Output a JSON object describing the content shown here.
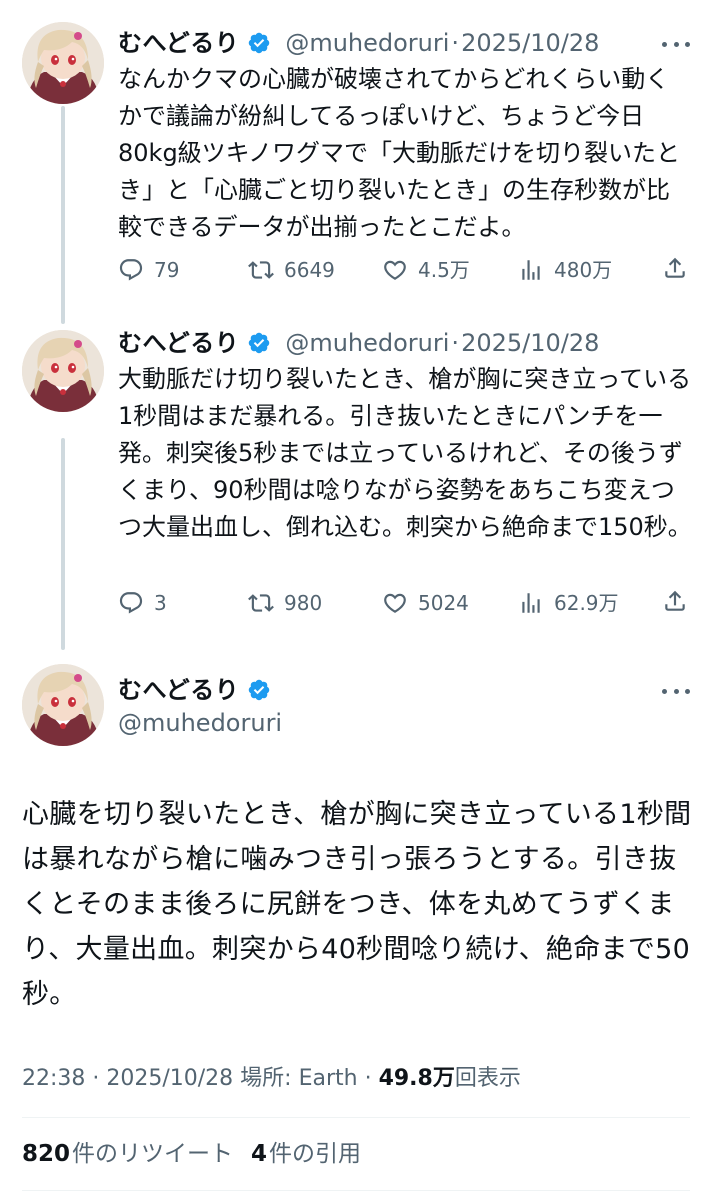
{
  "author": {
    "name": "むへどるり",
    "handle": "@muhedoruri",
    "verified_color": "#1d9bf0"
  },
  "tweets": [
    {
      "date": "2025/10/28",
      "text": "なんかクマの心臓が破壊されてからどれくらい動くかで議論が紛糾してるっぽいけど、ちょうど今日80kg級ツキノワグマで「大動脈だけを切り裂いたとき」と「心臓ごと切り裂いたとき」の生存秒数が比較できるデータが出揃ったとこだよ。",
      "replies": "79",
      "retweets": "6649",
      "likes": "4.5万",
      "views": "480万"
    },
    {
      "date": "2025/10/28",
      "text": "大動脈だけ切り裂いたとき、槍が胸に突き立っている1秒間はまだ暴れる。引き抜いたときにパンチを一発。刺突後5秒までは立っているけれど、その後うずくまり、90秒間は唸りながら姿勢をあちこち変えつつ大量出血し、倒れ込む。刺突から絶命まで150秒。",
      "replies": "3",
      "retweets": "980",
      "likes": "5024",
      "views": "62.9万"
    }
  ],
  "main_tweet": {
    "text": "心臓を切り裂いたとき、槍が胸に突き立っている1秒間は暴れながら槍に噛みつき引っ張ろうとする。引き抜くとそのまま後ろに尻餅をつき、体を丸めてうずくまり、大量出血。刺突から40秒間唸り続け、絶命まで50秒。",
    "time": "22:38 · 2025/10/28 場所: Earth · ",
    "views_count": "49.8万",
    "views_label": "回表示",
    "retweet_count": "820",
    "retweet_label": "件のリツイート",
    "quote_count": "4",
    "quote_label": "件の引用"
  },
  "icons": {
    "reply": "reply-icon",
    "retweet": "retweet-icon",
    "like": "heart-icon",
    "views": "analytics-icon",
    "share": "share-icon",
    "more": "more-icon",
    "verified": "verified-badge-icon"
  },
  "colors": {
    "text": "#0f1419",
    "secondary": "#536471",
    "thread_line": "#cfd9de",
    "divider": "#eff3f4"
  }
}
